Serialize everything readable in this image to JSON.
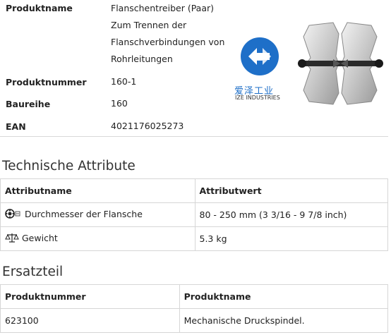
{
  "product": {
    "name_label": "Produktname",
    "name_value_lines": [
      "Flanschentreiber (Paar)",
      "Zum Trennen der",
      "Flanschverbindungen von",
      "Rohrleitungen"
    ],
    "number_label": "Produktnummer",
    "number_value": "160-1",
    "series_label": "Baureihe",
    "series_value": "160",
    "ean_label": "EAN",
    "ean_value": "4021176025273"
  },
  "logo": {
    "chinese": "爱泽工业",
    "english": "IZE INDUSTRIES",
    "color": "#1e6fc8"
  },
  "attributes": {
    "title": "Technische Attribute",
    "col_name": "Attributname",
    "col_value": "Attributwert",
    "rows": [
      {
        "icon": "flange-bolt-icon",
        "name": "Durchmesser der Flansche",
        "value": "80 - 250 mm (3 3/16 - 9 7/8 inch)"
      },
      {
        "icon": "scale-icon",
        "name": "Gewicht",
        "value": "5.3 kg"
      }
    ]
  },
  "spares": {
    "title": "Ersatzteil",
    "col_number": "Produktnummer",
    "col_name": "Produktname",
    "rows": [
      {
        "number": "623100",
        "name": "Mechanische Druckspindel."
      }
    ]
  }
}
